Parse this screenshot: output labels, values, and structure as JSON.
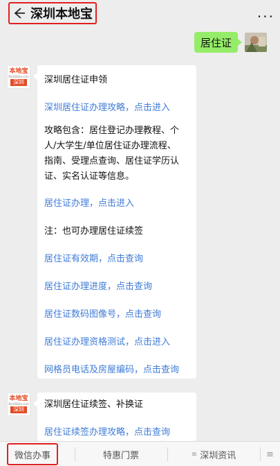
{
  "header": {
    "title": "深圳本地宝",
    "more": "..."
  },
  "user_message": {
    "text": "居住证"
  },
  "bot": {
    "logo": {
      "name": "本地宝",
      "url": "BenDiBao.com",
      "city": "深圳"
    }
  },
  "messages": [
    {
      "lines": [
        {
          "text": "深圳居住证申领",
          "kind": "text"
        },
        {
          "text": "深圳居住证办理攻略，点击进入",
          "kind": "link"
        },
        {
          "text": "攻略包含：居住登记办理教程、个人/大学生/单位居住证办理流程、指南、受理点查询、居住证学历认证、实名认证等信息。",
          "kind": "para"
        },
        {
          "text": "居住证办理，点击进入",
          "kind": "link"
        },
        {
          "text": "注：也可办理居住证续签",
          "kind": "text"
        },
        {
          "text": "居住证有效期，点击查询",
          "kind": "link"
        },
        {
          "text": "居住证办理进度，点击查询",
          "kind": "link"
        },
        {
          "text": "居住证数码图像号，点击查询",
          "kind": "link"
        },
        {
          "text": "居住证办理资格测试，点击进入",
          "kind": "link"
        },
        {
          "text": "网格员电话及房屋编码，点击查询",
          "kind": "link"
        }
      ]
    },
    {
      "lines": [
        {
          "text": "深圳居住证续签、补换证",
          "kind": "text"
        },
        {
          "text": "居住证续签办理攻略，点击查询",
          "kind": "link"
        }
      ]
    }
  ],
  "para_lines": [
    "攻略包含：居住登记办理教程、个",
    "人/大学生/单位居住证办理流程、",
    "指南、受理点查询、居住证学历认",
    "证、实名认证等信息。"
  ],
  "bottom_menu": {
    "tabs": [
      "微信办事",
      "特惠门票",
      "深圳资讯"
    ],
    "overflow": "≡"
  },
  "colors": {
    "link": "#3f7bd6",
    "user_bubble": "#95ec69",
    "highlight": "#e02020",
    "brand": "#e34a25"
  }
}
